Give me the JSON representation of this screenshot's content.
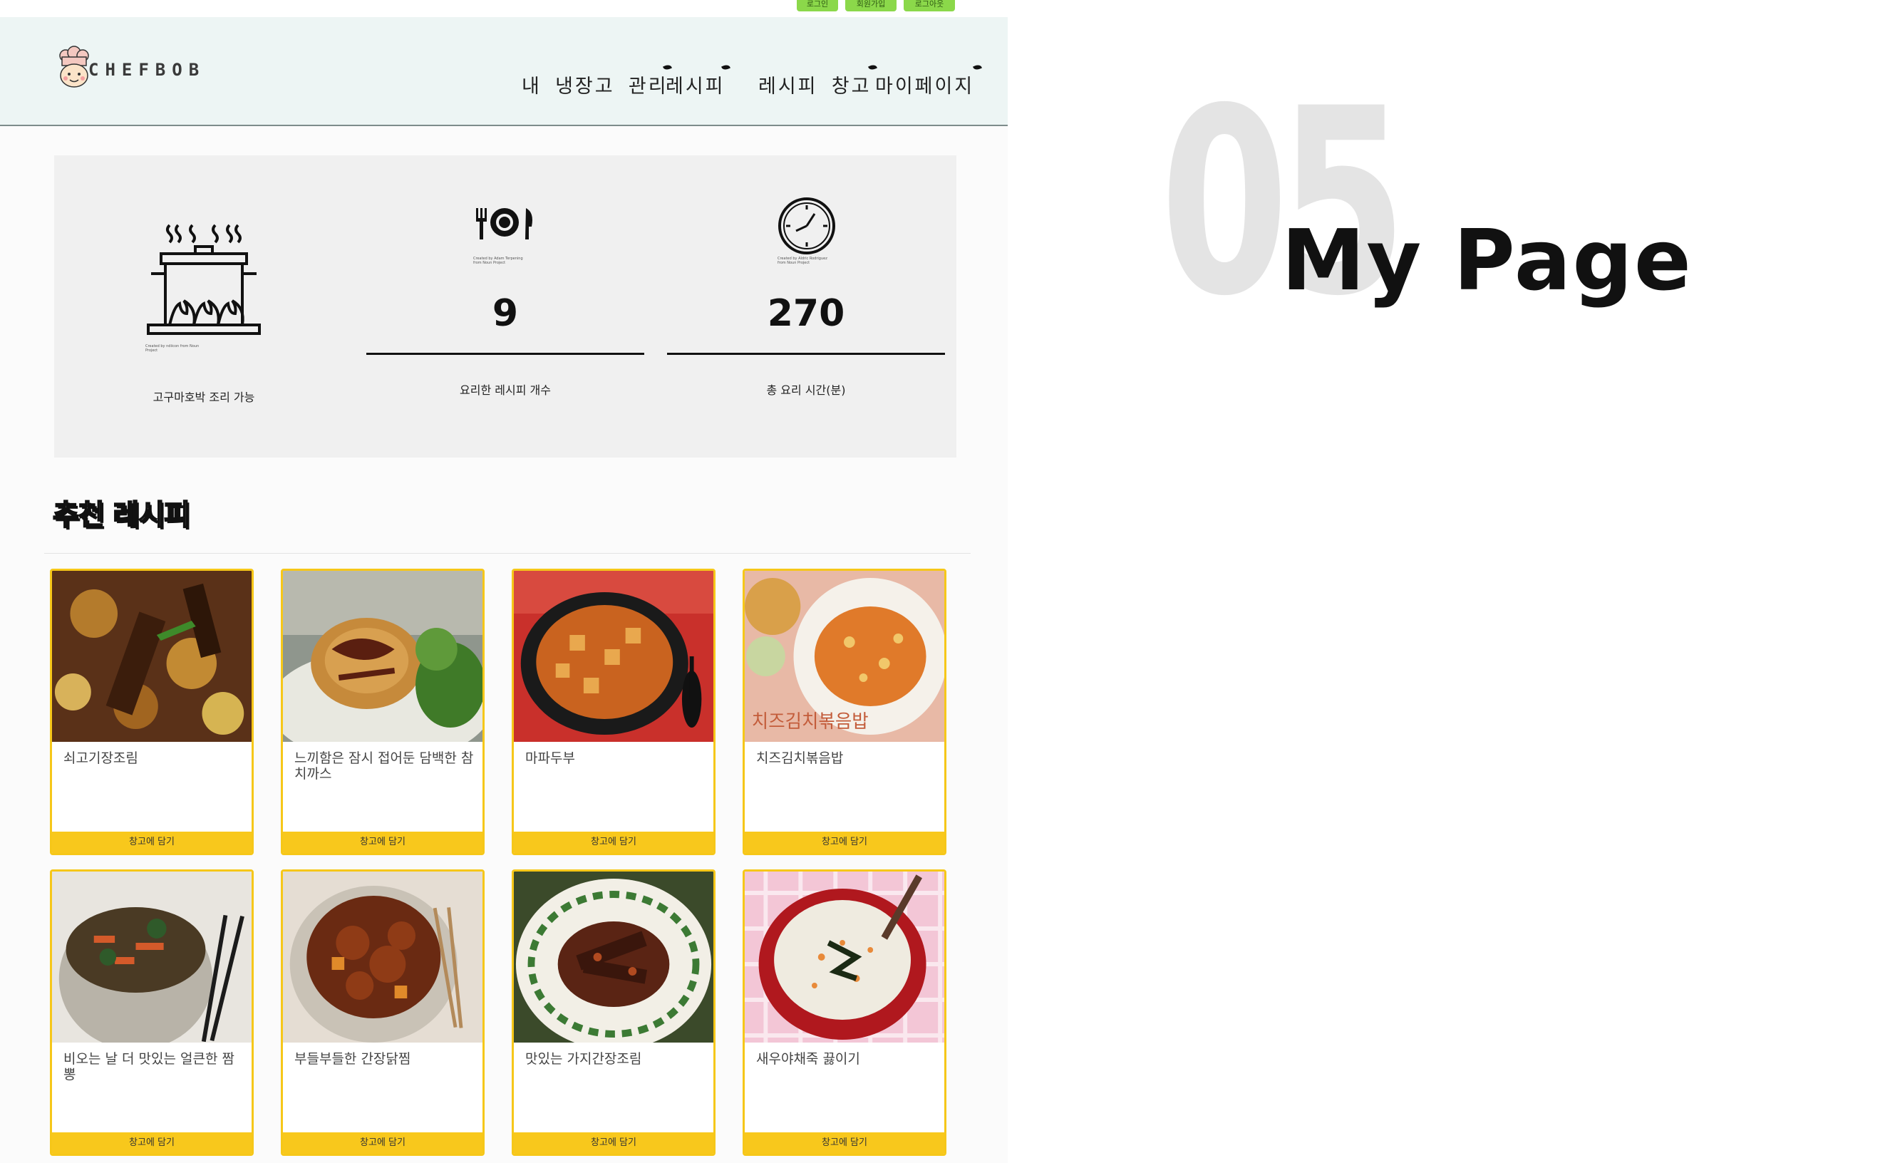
{
  "auth_links": [
    "로그인",
    "회원가입",
    "로그아웃"
  ],
  "brand": {
    "name": "CHEFBOB",
    "logo_icon": "chef-hat-mascot-icon"
  },
  "nav": {
    "items": [
      {
        "label": "내 냉장고 관리"
      },
      {
        "label": "레시피"
      },
      {
        "label": "레시피 창고"
      },
      {
        "label": "마이페이지"
      }
    ]
  },
  "stats": {
    "available": {
      "icon": "cooking-pot-icon",
      "label": "고구마호박 조리 가능",
      "credit": "Created by ndiicon from Noun Project"
    },
    "recipe_count": {
      "icon": "plate-cutlery-icon",
      "value": "9",
      "label": "요리한 레시피 개수",
      "credit": "Created by Adam Terpening from Noun Project"
    },
    "total_time": {
      "icon": "clock-icon",
      "value": "270",
      "label": "총 요리 시간(분)",
      "credit": "Created by Aldric Rodriguez from Noun Project"
    }
  },
  "recommend": {
    "title": "추천 레시피",
    "button_label": "창고에 담기",
    "cards": [
      {
        "title": "쇠고기장조림",
        "image": "braised-beef-eggs-image"
      },
      {
        "title": "느끼함은 잠시 접어둔 담백한 참치까스",
        "image": "tuna-cutlet-image"
      },
      {
        "title": "마파두부",
        "image": "mapo-tofu-image"
      },
      {
        "title": "치즈김치볶음밥",
        "image": "cheese-kimchi-fried-rice-image"
      },
      {
        "title": "비오는 날 더 맛있는 얼큰한 짬뽕",
        "image": "spicy-jjamppong-image"
      },
      {
        "title": "부들부들한 간장닭찜",
        "image": "soy-braised-chicken-image"
      },
      {
        "title": "맛있는 가지간장조림",
        "image": "braised-eggplant-image"
      },
      {
        "title": "새우야채죽 끓이기",
        "image": "shrimp-vegetable-porridge-image"
      }
    ]
  },
  "slide": {
    "number": "05",
    "heading": "My Page"
  },
  "colors": {
    "header_bg": "#edf5f4",
    "card_border": "#f6c719",
    "button": "#f8c81c",
    "auth_button": "#8bd84a"
  }
}
